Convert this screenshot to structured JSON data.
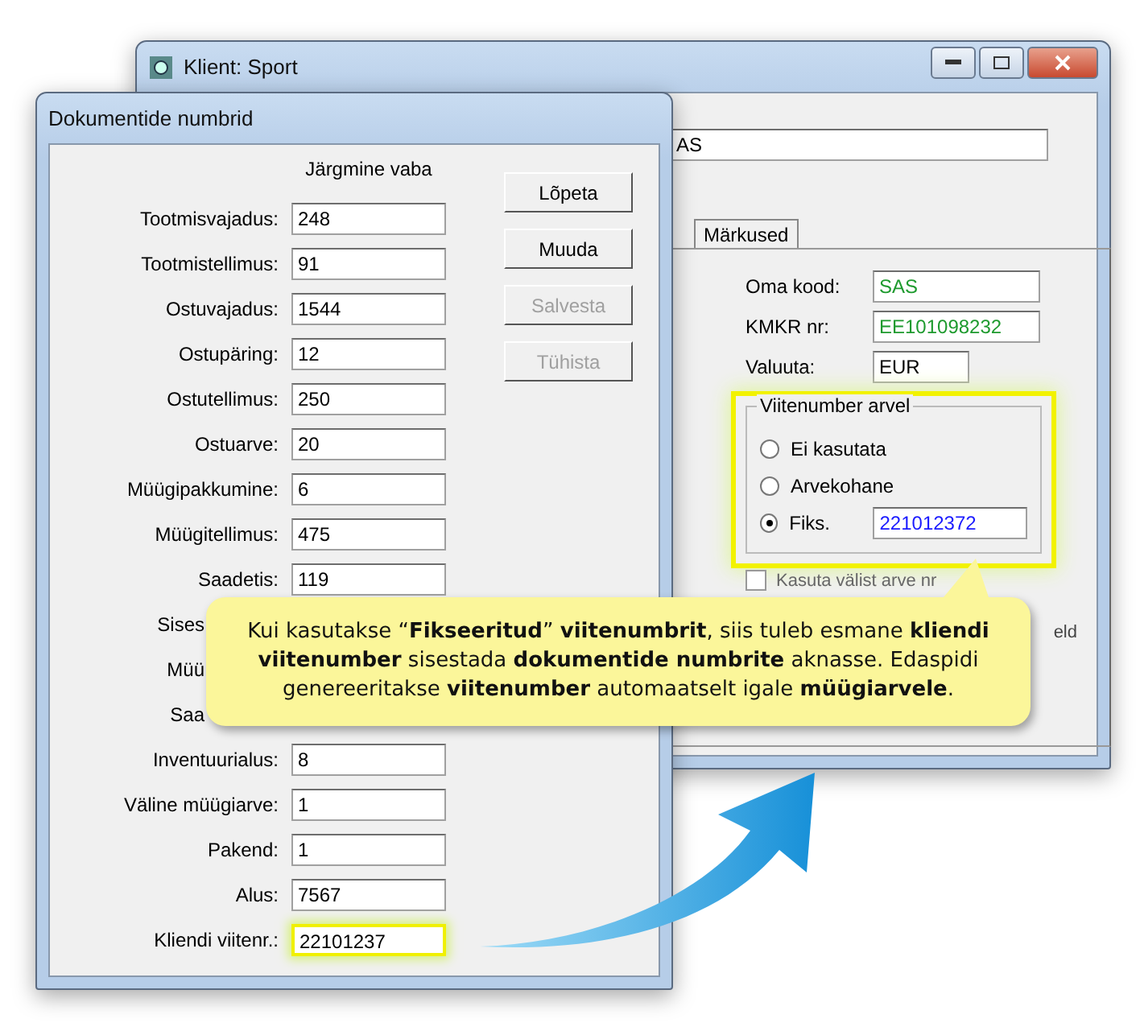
{
  "background_window": {
    "title": "Klient: Sport",
    "name_field": "AS",
    "tabs": [
      {
        "label": "Märkused",
        "selected": false
      }
    ],
    "fields": [
      {
        "label": "Oma kood:",
        "value": "SAS",
        "color": "#1e9a2e"
      },
      {
        "label": "KMKR nr:",
        "value": "EE101098232",
        "color": "#1e9a2e"
      },
      {
        "label": "Valuuta:",
        "value": "EUR",
        "color": "#000000"
      }
    ],
    "reference_group": {
      "title": "Viitenumber arvel",
      "highlighted": true,
      "options": [
        {
          "label": "Ei kasutata",
          "selected": false
        },
        {
          "label": "Arvekohane",
          "selected": false
        },
        {
          "label": "Fiks.",
          "selected": true,
          "value": "221012372",
          "color": "#1a1aff"
        }
      ]
    },
    "checkbox": {
      "label": "Kasuta välist arve nr",
      "checked": false
    },
    "fragment": "eld"
  },
  "dialog": {
    "title": "Dokumentide numbrid",
    "heading": "Järgmine vaba",
    "rows": [
      {
        "label": "Tootmisvajadus:",
        "value": "248",
        "highlighted": false
      },
      {
        "label": "Tootmistellimus:",
        "value": "91",
        "highlighted": false
      },
      {
        "label": "Ostuvajadus:",
        "value": "1544",
        "highlighted": false
      },
      {
        "label": "Ostupäring:",
        "value": "12",
        "highlighted": false
      },
      {
        "label": "Ostutellimus:",
        "value": "250",
        "highlighted": false
      },
      {
        "label": "Ostuarve:",
        "value": "20",
        "highlighted": false
      },
      {
        "label": "Müügipakkumine:",
        "value": "6",
        "highlighted": false
      },
      {
        "label": "Müügitellimus:",
        "value": "475",
        "highlighted": false
      },
      {
        "label": "Saadetis:",
        "value": "119",
        "highlighted": false
      },
      {
        "label": "Sises"
      },
      {
        "label": "Müü"
      },
      {
        "label": "Saa"
      },
      {
        "label": "Inventuurialus:",
        "value": "8",
        "highlighted": false
      },
      {
        "label": "Väline müügiarve:",
        "value": "1",
        "highlighted": false
      },
      {
        "label": "Pakend:",
        "value": "1",
        "highlighted": false
      },
      {
        "label": "Alus:",
        "value": "7567",
        "highlighted": false
      },
      {
        "label": "Kliendi viitenr.:",
        "value": "22101237",
        "highlighted": true
      }
    ],
    "buttons": [
      {
        "label": "Lõpeta",
        "disabled": false
      },
      {
        "label": "Muuda",
        "disabled": false
      },
      {
        "label": "Salvesta",
        "disabled": true
      },
      {
        "label": "Tühista",
        "disabled": true
      }
    ]
  },
  "callout": {
    "text": "Kui kasutakse “**Fikseeritud**” **viitenumbrit**, siis tuleb esmane **kliendi viitenumber** sisestada **dokumentide numbrite** aknasse. Edaspidi genereeritakse **viitenumber** automaatselt igale **müügiarvele**."
  }
}
